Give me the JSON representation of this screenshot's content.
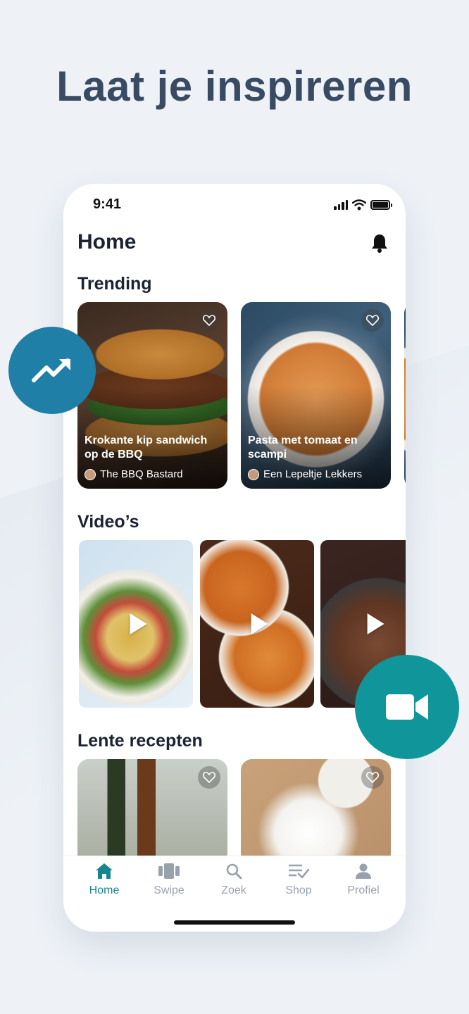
{
  "headline": "Laat je inspireren",
  "status": {
    "time": "9:41"
  },
  "app": {
    "title": "Home"
  },
  "sections": {
    "trending": "Trending",
    "videos": "Video’s",
    "spring": "Lente recepten"
  },
  "trending_cards": [
    {
      "title": "Krokante kip sandwich op de BBQ",
      "author": "The BBQ Bastard"
    },
    {
      "title": "Pasta met tomaat en scampi",
      "author": "Een Lepeltje Lekkers"
    }
  ],
  "tabbar": [
    {
      "label": "Home",
      "icon": "home-icon"
    },
    {
      "label": "Swipe",
      "icon": "swipe-cards-icon"
    },
    {
      "label": "Zoek",
      "icon": "search-icon"
    },
    {
      "label": "Shop",
      "icon": "shopping-list-icon"
    },
    {
      "label": "Profiel",
      "icon": "person-icon"
    }
  ],
  "colors": {
    "accent": "#15868f",
    "trending_fab": "#1f7fa6",
    "video_fab": "#10959a",
    "headline": "#394a63",
    "background": "#eef2f7"
  }
}
